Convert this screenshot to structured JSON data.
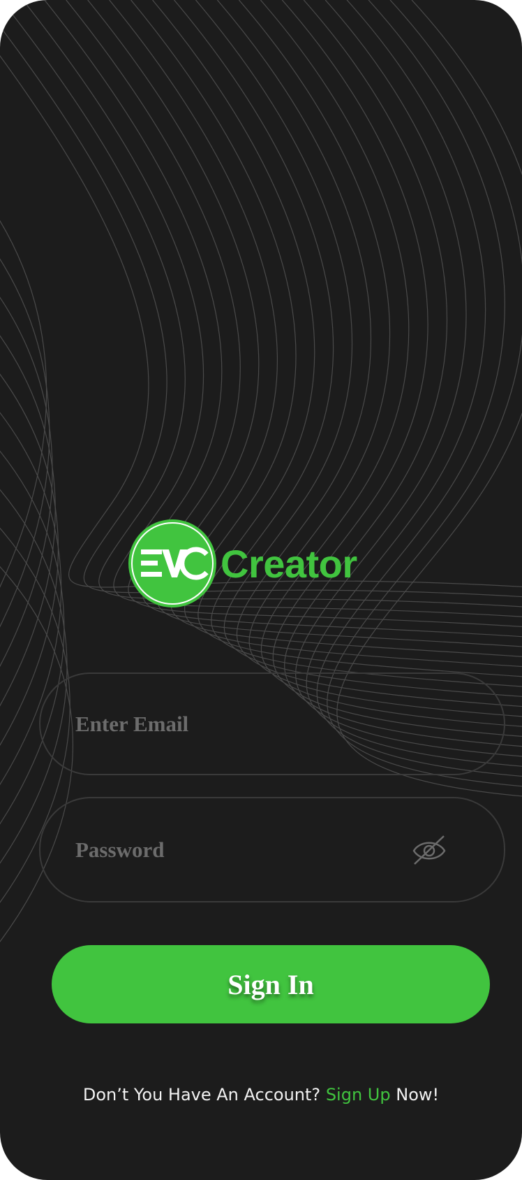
{
  "brand": {
    "badge_text": "EVC",
    "name": "Creator",
    "accent_color": "#41c43f"
  },
  "form": {
    "email_placeholder": "Enter Email",
    "email_value": "",
    "password_placeholder": "Password",
    "password_value": "",
    "password_toggle_icon": "eye-off-icon",
    "submit_label": "Sign In"
  },
  "footer": {
    "prefix": "Don’t You Have An Account?",
    "link_label": "Sign Up",
    "suffix": "Now!"
  }
}
